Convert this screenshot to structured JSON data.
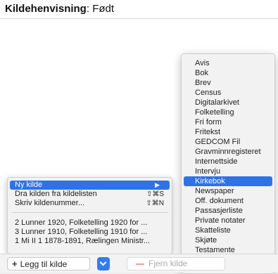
{
  "title": {
    "label": "Kildehenvisning",
    "value": ": Født"
  },
  "menu": {
    "items": [
      {
        "label": "Ny kilde",
        "shortcut": "▶"
      },
      {
        "label": "Dra kilden fra kildelisten",
        "shortcut": "⇧⌘S"
      },
      {
        "label": "Skriv kildenummer...",
        "shortcut": "⇧⌘N"
      }
    ],
    "recent": [
      "2 Lunner 1920, Folketelling 1920 for ...",
      "3 Lunner 1910, Folketelling 1910 for ...",
      "1 Mi II 1 1878-1891, Rælingen Ministr..."
    ]
  },
  "submenu": {
    "items": [
      "Avis",
      "Bok",
      "Brev",
      "Census",
      "Digitalarkivet",
      "Folketelling",
      "Fri form",
      "Fritekst",
      "GEDCOM Fil",
      "Gravminnregisteret",
      "Internettside",
      "Intervju",
      "Kirkebok",
      "Newspaper",
      "Off. dokument",
      "Passasjerliste",
      "Private notater",
      "Skatteliste",
      "Skjøte",
      "Testamente"
    ],
    "selected": "Kirkebok"
  },
  "toolbar": {
    "add_label": "Legg til kilde",
    "remove_label": "Fjern kilde"
  }
}
